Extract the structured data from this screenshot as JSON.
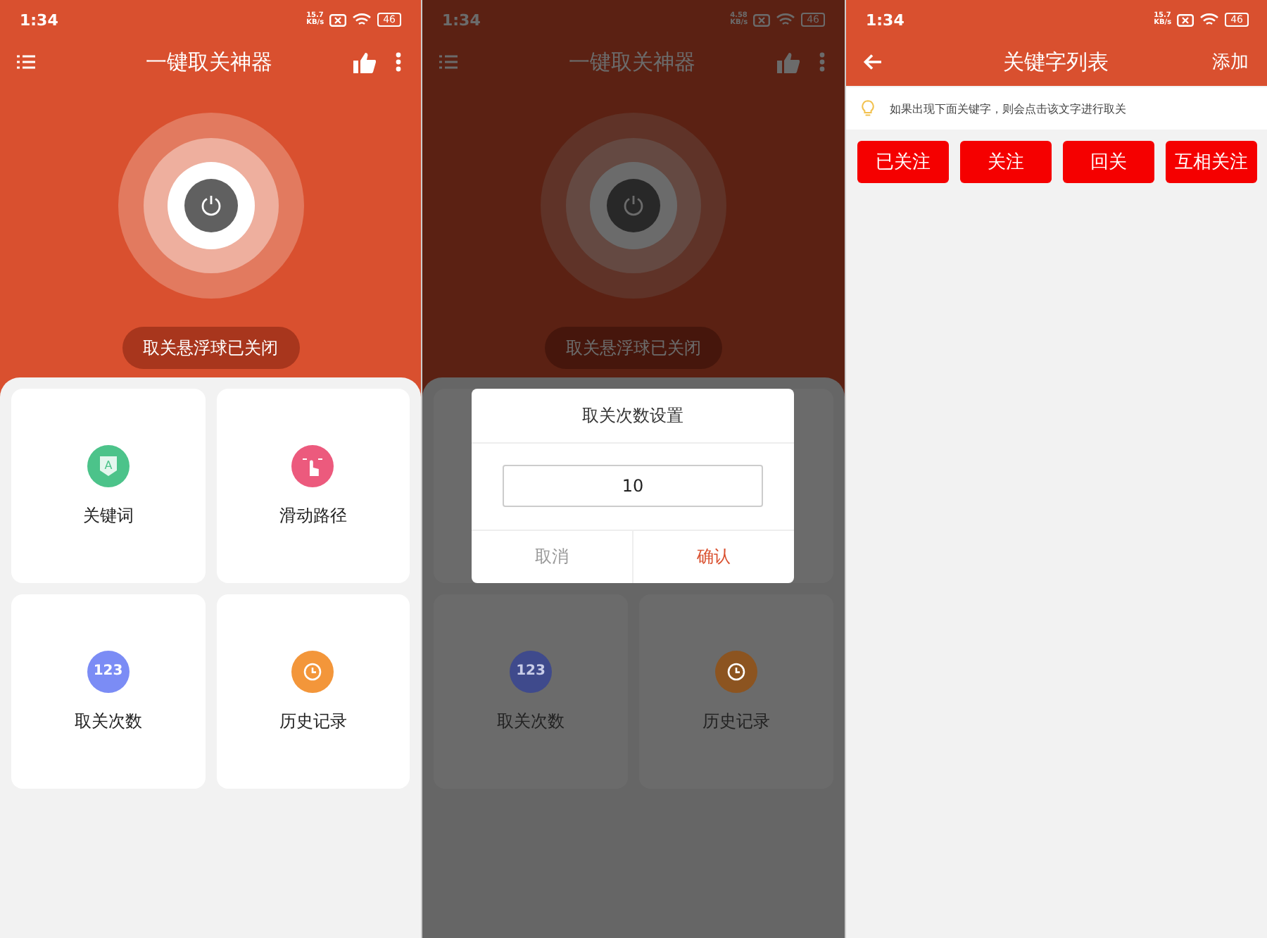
{
  "screens": [
    {
      "kind": "home",
      "status": {
        "time": "1:34",
        "speed": "15.7",
        "speed_unit": "KB/s",
        "battery": "46"
      },
      "title": "一键取关神器",
      "toggle_label": "取关悬浮球已关闭",
      "tiles": [
        {
          "kind": "keyword",
          "label": "关键词",
          "color": "#4cc38a",
          "glyph": "A"
        },
        {
          "kind": "swipe",
          "label": "滑动路径",
          "color": "#ec5a7d"
        },
        {
          "kind": "count",
          "label": "取关次数",
          "color": "#7b8cf5",
          "glyph": "123"
        },
        {
          "kind": "history",
          "label": "历史记录",
          "color": "#f3963a"
        }
      ]
    },
    {
      "kind": "home",
      "status": {
        "time": "1:34",
        "speed": "4.58",
        "speed_unit": "KB/s",
        "battery": "46"
      },
      "title": "一键取关神器",
      "toggle_label": "取关悬浮球已关闭",
      "tiles": [
        {
          "kind": "covered"
        },
        {
          "kind": "covered"
        },
        {
          "kind": "count",
          "label": "取关次数",
          "color": "#3f4a8c",
          "glyph": "123"
        },
        {
          "kind": "history",
          "label": "历史记录",
          "color": "#8c5420"
        }
      ],
      "dialog": {
        "title": "取关次数设置",
        "value": "10",
        "cancel": "取消",
        "confirm": "确认"
      }
    },
    {
      "kind": "keywords",
      "status": {
        "time": "1:34",
        "speed": "15.7",
        "speed_unit": "KB/s",
        "battery": "46"
      },
      "title": "关键字列表",
      "action": "添加",
      "hint": "如果出现下面关键字，则会点击该文字进行取关",
      "keywords": [
        "已关注",
        "关注",
        "回关",
        "互相关注"
      ]
    }
  ]
}
